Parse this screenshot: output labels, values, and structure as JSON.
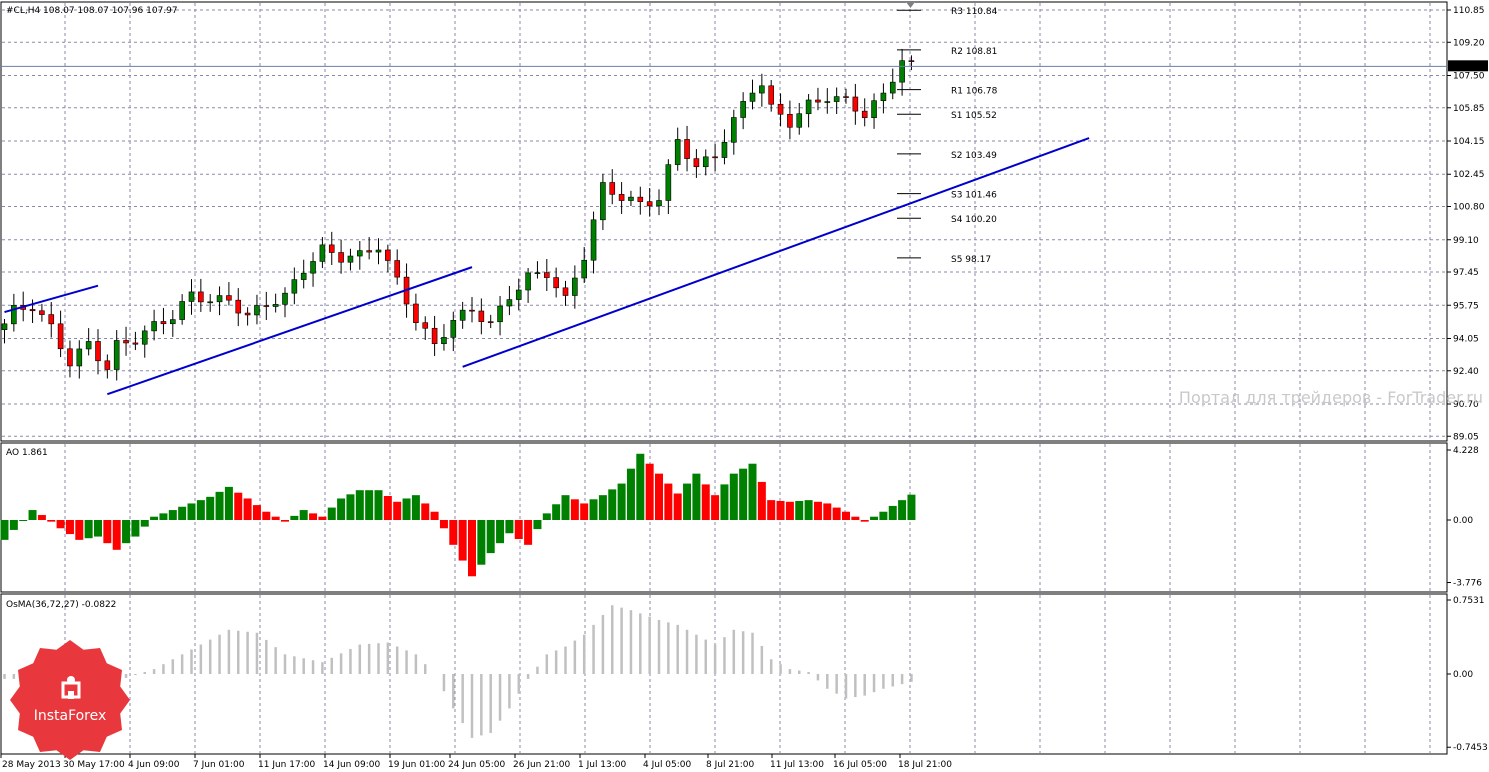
{
  "chart_data": [
    {
      "type": "candlestick",
      "header": "#CL,H4  108.07 108.07 107.96 107.97",
      "ylim": [
        89.05,
        111.5
      ],
      "y_ticks": [
        "110.85",
        "109.20",
        "107.50",
        "105.85",
        "104.15",
        "102.45",
        "100.80",
        "99.10",
        "97.45",
        "95.75",
        "94.05",
        "92.40",
        "90.70",
        "89.05"
      ],
      "last_price": "107.97",
      "grid": true,
      "x_tick_labels": [
        "28 May 2013",
        "30 May 17:00",
        "4 Jun 09:00",
        "7 Jun 01:00",
        "11 Jun 17:00",
        "14 Jun 09:00",
        "19 Jun 01:00",
        "24 Jun 05:00",
        "26 Jun 21:00",
        "1 Jul 13:00",
        "4 Jul 05:00",
        "8 Jul 21:00",
        "11 Jul 13:00",
        "16 Jul 05:00",
        "18 Jul 21:00"
      ],
      "close_anchors": [
        [
          0,
          94.8
        ],
        [
          1,
          95.5
        ],
        [
          3,
          95.7
        ],
        [
          5,
          94.6
        ],
        [
          7,
          92.8
        ],
        [
          9,
          93.8
        ],
        [
          11,
          92.5
        ],
        [
          12,
          93.7
        ],
        [
          14,
          94.0
        ],
        [
          16,
          94.7
        ],
        [
          18,
          95.2
        ],
        [
          20,
          96.3
        ],
        [
          22,
          96.0
        ],
        [
          24,
          96.0
        ],
        [
          26,
          95.2
        ],
        [
          28,
          95.8
        ],
        [
          30,
          96.2
        ],
        [
          32,
          97.6
        ],
        [
          34,
          98.6
        ],
        [
          36,
          98.2
        ],
        [
          38,
          98.3
        ],
        [
          40,
          98.8
        ],
        [
          42,
          97.0
        ],
        [
          44,
          95.0
        ],
        [
          46,
          93.7
        ],
        [
          48,
          95.0
        ],
        [
          50,
          95.5
        ],
        [
          52,
          94.8
        ],
        [
          54,
          96.2
        ],
        [
          56,
          97.2
        ],
        [
          58,
          97.4
        ],
        [
          60,
          96.0
        ],
        [
          62,
          98.3
        ],
        [
          64,
          101.8
        ],
        [
          66,
          101.3
        ],
        [
          68,
          100.9
        ],
        [
          70,
          101.2
        ],
        [
          72,
          104.2
        ],
        [
          74,
          102.8
        ],
        [
          76,
          103.4
        ],
        [
          78,
          105.2
        ],
        [
          80,
          106.8
        ],
        [
          81,
          107.1
        ],
        [
          82,
          105.8
        ],
        [
          84,
          105.1
        ],
        [
          86,
          106.0
        ],
        [
          88,
          106.4
        ],
        [
          90,
          106.2
        ],
        [
          92,
          105.5
        ],
        [
          94,
          106.5
        ],
        [
          96,
          108.3
        ],
        [
          97,
          108.0
        ]
      ],
      "pivots": [
        {
          "label": "R3 110.84",
          "value": 110.84
        },
        {
          "label": "R2 108.81",
          "value": 108.81
        },
        {
          "label": "R1 106.78",
          "value": 106.78
        },
        {
          "label": "S1 105.52",
          "value": 105.52
        },
        {
          "label": "S2 103.49",
          "value": 103.49
        },
        {
          "label": "S3 101.46",
          "value": 101.46
        },
        {
          "label": "S4 100.20",
          "value": 100.2
        },
        {
          "label": "S5 98.17",
          "value": 98.17
        }
      ],
      "trendlines": [
        {
          "from": [
            0,
            95.4
          ],
          "to": [
            10,
            96.75
          ]
        },
        {
          "from": [
            11,
            91.2
          ],
          "to": [
            50,
            97.7
          ]
        },
        {
          "from": [
            49,
            92.6
          ],
          "to": [
            116,
            104.3
          ]
        }
      ],
      "watermark": "Портал для трейдеров - ForTrader.ru"
    },
    {
      "type": "bar",
      "header": "AO 1.861",
      "ylim": [
        -3.776,
        4.228
      ],
      "y_ticks": [
        "4.228",
        "0.00",
        "-3.776"
      ],
      "anchors": [
        [
          0,
          -1.2
        ],
        [
          3,
          0.6
        ],
        [
          4,
          0.3
        ],
        [
          6,
          -0.5
        ],
        [
          8,
          -1.2
        ],
        [
          10,
          -1.0
        ],
        [
          12,
          -1.8
        ],
        [
          14,
          -1.0
        ],
        [
          16,
          0.2
        ],
        [
          18,
          0.6
        ],
        [
          20,
          1.0
        ],
        [
          22,
          1.4
        ],
        [
          24,
          2.0
        ],
        [
          26,
          1.3
        ],
        [
          28,
          0.5
        ],
        [
          30,
          -0.1
        ],
        [
          32,
          0.6
        ],
        [
          34,
          0.2
        ],
        [
          36,
          1.3
        ],
        [
          38,
          1.8
        ],
        [
          40,
          1.8
        ],
        [
          42,
          1.1
        ],
        [
          44,
          1.5
        ],
        [
          46,
          0.5
        ],
        [
          48,
          -1.5
        ],
        [
          50,
          -3.4
        ],
        [
          52,
          -2.0
        ],
        [
          54,
          -0.8
        ],
        [
          56,
          -1.5
        ],
        [
          58,
          0.4
        ],
        [
          60,
          1.5
        ],
        [
          62,
          1.0
        ],
        [
          64,
          1.5
        ],
        [
          66,
          2.2
        ],
        [
          68,
          4.0
        ],
        [
          70,
          2.8
        ],
        [
          72,
          1.6
        ],
        [
          74,
          2.8
        ],
        [
          76,
          1.5
        ],
        [
          78,
          2.8
        ],
        [
          80,
          3.4
        ],
        [
          82,
          1.2
        ],
        [
          84,
          1.1
        ],
        [
          86,
          1.2
        ],
        [
          88,
          1.0
        ],
        [
          90,
          0.5
        ],
        [
          92,
          -0.1
        ],
        [
          94,
          0.5
        ],
        [
          96,
          1.2
        ],
        [
          98,
          1.86
        ]
      ]
    },
    {
      "type": "bar",
      "header": "OsMA(36,72,27) -0.0822",
      "ylim": [
        -0.7453,
        0.7531
      ],
      "y_ticks": [
        "0.7531",
        "0.00",
        "-0.7453"
      ],
      "anchors": [
        [
          0,
          -0.05
        ],
        [
          4,
          -0.05
        ],
        [
          8,
          -0.08
        ],
        [
          12,
          -0.07
        ],
        [
          16,
          0.05
        ],
        [
          20,
          0.25
        ],
        [
          24,
          0.45
        ],
        [
          27,
          0.42
        ],
        [
          30,
          0.2
        ],
        [
          34,
          0.12
        ],
        [
          38,
          0.3
        ],
        [
          41,
          0.32
        ],
        [
          44,
          0.2
        ],
        [
          46,
          0.0
        ],
        [
          48,
          -0.35
        ],
        [
          50,
          -0.65
        ],
        [
          52,
          -0.6
        ],
        [
          54,
          -0.35
        ],
        [
          56,
          -0.05
        ],
        [
          58,
          0.2
        ],
        [
          60,
          0.28
        ],
        [
          62,
          0.4
        ],
        [
          65,
          0.7
        ],
        [
          67,
          0.65
        ],
        [
          70,
          0.55
        ],
        [
          72,
          0.5
        ],
        [
          74,
          0.4
        ],
        [
          76,
          0.3
        ],
        [
          78,
          0.45
        ],
        [
          80,
          0.42
        ],
        [
          82,
          0.15
        ],
        [
          84,
          0.05
        ],
        [
          86,
          0.02
        ],
        [
          88,
          -0.15
        ],
        [
          90,
          -0.25
        ],
        [
          92,
          -0.22
        ],
        [
          94,
          -0.15
        ],
        [
          97,
          -0.08
        ]
      ]
    }
  ],
  "logo": {
    "text": "InstaForex"
  },
  "colors": {
    "bull": "#008000",
    "bear": "#ff0000",
    "ao_up": "#008000",
    "ao_down": "#ff0000",
    "osma": "#c0c0c0",
    "trendline": "#0000cc",
    "grid": "#8a8aa8",
    "logo": "#e8383d"
  }
}
